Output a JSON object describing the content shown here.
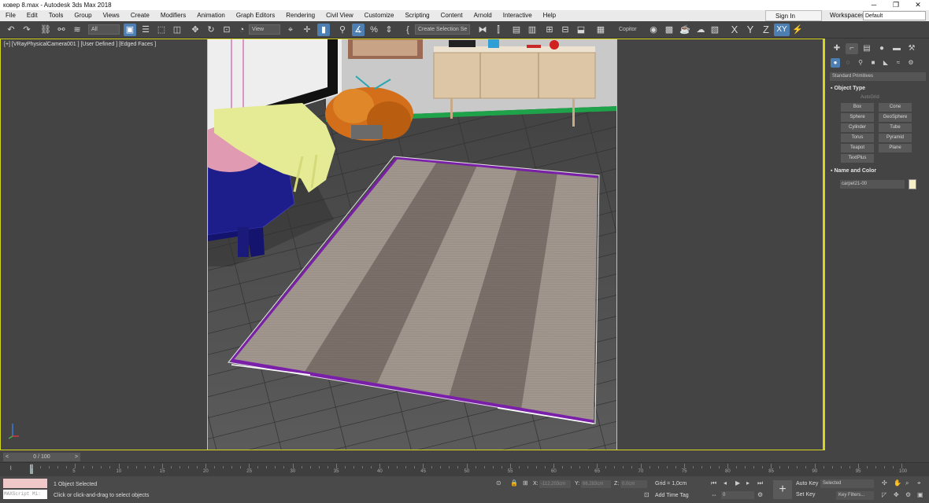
{
  "window": {
    "title": "ковер 8.max - Autodesk 3ds Max 2018",
    "minimize": "─",
    "restore": "❐",
    "close": "✕"
  },
  "menu": {
    "items": [
      "File",
      "Edit",
      "Tools",
      "Group",
      "Views",
      "Create",
      "Modifiers",
      "Animation",
      "Graph Editors",
      "Rendering",
      "Civil View",
      "Customize",
      "Scripting",
      "Content",
      "Arnold",
      "Interactive",
      "Help"
    ],
    "sign_in": "Sign In",
    "workspaces_label": "Workspaces:",
    "workspace": "Default"
  },
  "toolbar": {
    "filter": "All",
    "coord_system": "View",
    "selection_set": "Create Selection Se",
    "copitor": "Copitor",
    "axis_x": "X",
    "axis_y": "Y",
    "axis_z": "Z",
    "axis_xy": "XY"
  },
  "viewport": {
    "label": "[+] [VRayPhysicalCamera001 ] [User Defined ] [Edged Faces ]",
    "border_color": "#d6d61f",
    "selection_color": "#7a1fa8"
  },
  "command_panel": {
    "category": "Standard Primitives",
    "object_type_header": "Object Type",
    "autogrid": "AutoGrid",
    "primitives": [
      "Box",
      "Cone",
      "Sphere",
      "GeoSphere",
      "Cylinder",
      "Tube",
      "Torus",
      "Pyramid",
      "Teapot",
      "Plane",
      "TextPlus"
    ],
    "name_color_header": "Name and Color",
    "object_name": "carpet21-00",
    "object_color": "#f5efc8"
  },
  "timeline": {
    "frame_display": "0 / 100",
    "prev": "<",
    "next": ">",
    "ticks": [
      "0",
      "5",
      "10",
      "15",
      "20",
      "25",
      "30",
      "35",
      "40",
      "45",
      "50",
      "55",
      "60",
      "65",
      "70",
      "75",
      "80",
      "85",
      "90",
      "95",
      "100"
    ]
  },
  "status": {
    "maxscript": "MAXScript Mi:",
    "selection_info": "1 Object Selected",
    "prompt": "Click or click-and-drag to select objects",
    "x_label": "X:",
    "x_value": "-112,203cm",
    "y_label": "Y:",
    "y_value": "66,283cm",
    "z_label": "Z:",
    "z_value": "0,0cm",
    "grid": "Grid = 1,0cm",
    "add_time_tag": "Add Time Tag",
    "auto_key": "Auto Key",
    "set_key": "Set Key",
    "key_mode": "Selected",
    "frame_field": "0",
    "key_filters": "Key Filters..."
  }
}
